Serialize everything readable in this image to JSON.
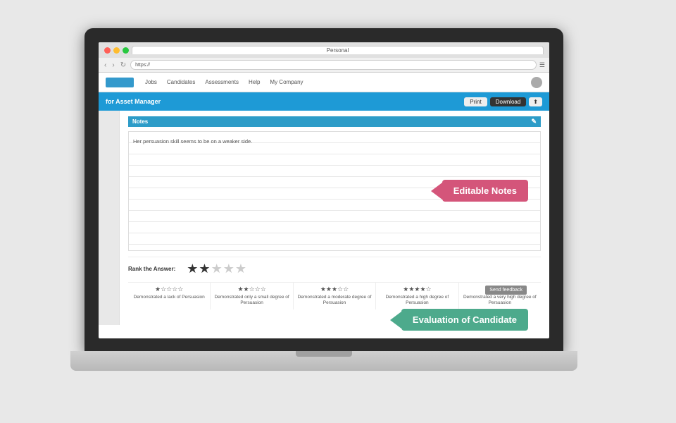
{
  "browser": {
    "tab_label": "Personal",
    "address": "https://",
    "back": "‹",
    "forward": "›",
    "reload": "↻"
  },
  "app": {
    "nav": {
      "items": [
        "Jobs",
        "Candidates",
        "Assessments",
        "Help",
        "My Company"
      ]
    },
    "header": {
      "title": "for Asset Manager",
      "print_label": "Print",
      "download_label": "Download",
      "share_label": "⬆"
    },
    "notes_label": "Notes",
    "notes_text": "Her persuasion skill seems to be on a weaker side.",
    "rank_label": "Rank the Answer:",
    "stars_filled": 2,
    "stars_total": 5,
    "rating_descriptions": [
      {
        "stars": "★☆☆☆☆",
        "text": "Demonstrated a lack of Persuasion"
      },
      {
        "stars": "★★☆☆☆",
        "text": "Demonstrated only a small degree of Persuasion"
      },
      {
        "stars": "★★★☆☆",
        "text": "Demonstrated a moderate degree of Persuasion"
      },
      {
        "stars": "★★★★☆",
        "text": "Demonstrated a high degree of Persuasion"
      },
      {
        "stars": "★★★★★",
        "text": "Demonstrated a very high degree of Persuasion"
      }
    ]
  },
  "callouts": {
    "editable_notes": "Editable Notes",
    "evaluation": "Evaluation of Candidate"
  },
  "send_feedback": "Send feedback"
}
